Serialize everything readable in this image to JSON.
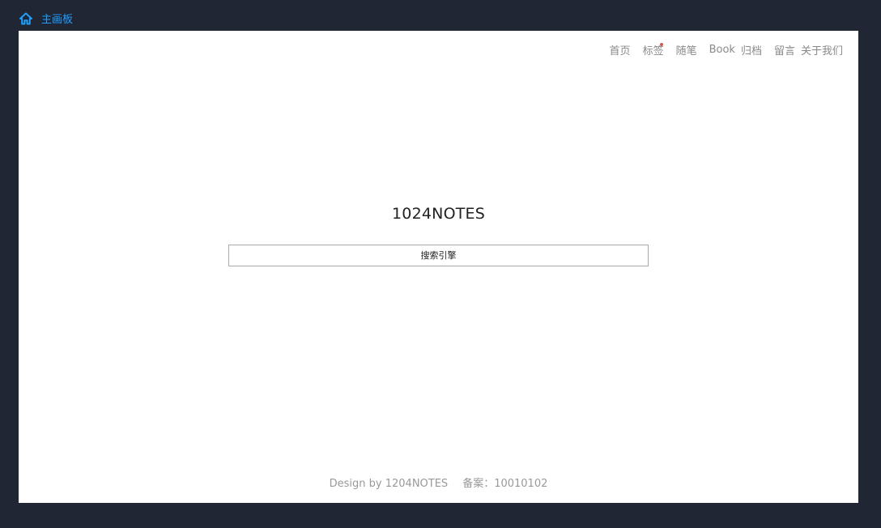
{
  "topbar": {
    "home_label": "主画板",
    "icon": "home-icon",
    "accent_color": "#1e9fff"
  },
  "nav": {
    "items": [
      {
        "label": "首页"
      },
      {
        "label": "标签",
        "has_dot": true
      },
      {
        "label": "随笔"
      },
      {
        "label": "Book"
      },
      {
        "label": "归档"
      },
      {
        "label": "留言"
      },
      {
        "label": "关于我们"
      }
    ]
  },
  "main": {
    "title": "1024NOTES",
    "search": {
      "placeholder": "搜索引擎",
      "value": ""
    }
  },
  "footer": {
    "design_text": "Design by 1204NOTES",
    "record_text": "备案：10010102"
  },
  "colors": {
    "background": "#202634",
    "panel": "#ffffff",
    "nav_text": "#8a8a8a",
    "notification_dot": "#d9534f"
  }
}
